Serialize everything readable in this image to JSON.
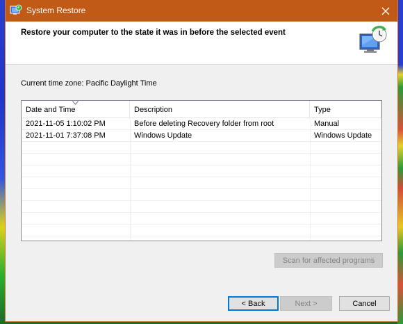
{
  "window": {
    "title": "System Restore"
  },
  "header": {
    "title": "Restore your computer to the state it was in before the selected event"
  },
  "timezone_label": "Current time zone: Pacific Daylight Time",
  "table": {
    "columns": [
      "Date and Time",
      "Description",
      "Type"
    ],
    "rows": [
      {
        "date": "2021-11-05 1:10:02 PM",
        "description": "Before deleting Recovery folder from root",
        "type": "Manual"
      },
      {
        "date": "2021-11-01 7:37:08 PM",
        "description": "Windows Update",
        "type": "Windows Update"
      }
    ]
  },
  "buttons": {
    "scan": "Scan for affected programs",
    "back": "< Back",
    "next": "Next >",
    "cancel": "Cancel"
  },
  "colors": {
    "titlebar": "#c05a16",
    "accent": "#0078d7"
  }
}
